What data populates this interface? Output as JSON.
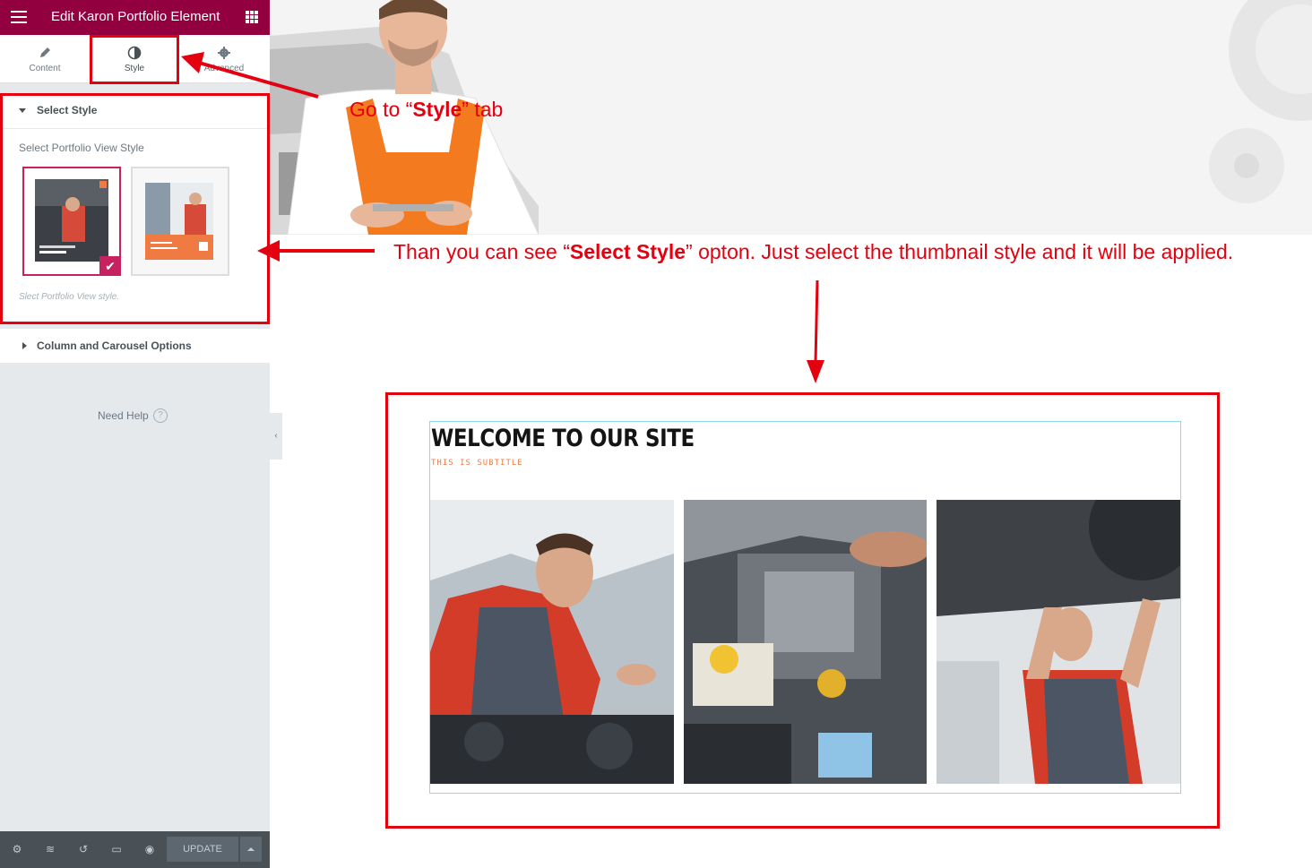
{
  "panel": {
    "title": "Edit Karon Portfolio Element",
    "tabs": [
      {
        "label": "Content",
        "icon": "pencil-icon"
      },
      {
        "label": "Style",
        "icon": "half-circle-icon"
      },
      {
        "label": "Advanced",
        "icon": "gear-icon"
      }
    ],
    "select_style": {
      "title": "Select Style",
      "control_label": "Select Portfolio View Style",
      "thumb_1_selected": true,
      "description": "Slect Portfolio View style."
    },
    "column_carousel": {
      "title": "Column and Carousel Options"
    },
    "need_help": "Need Help",
    "footer": {
      "update_label": "UPDATE"
    }
  },
  "annotations": {
    "go_to_style_pre": "Go  to “",
    "go_to_style_bold": "Style",
    "go_to_style_post": "” tab",
    "select_style_pre": "Than you  can see “",
    "select_style_bold": "Select Style",
    "select_style_post": "” opton. Just select the thumbnail style and it will be applied."
  },
  "preview": {
    "heading": "WELCOME TO OUR SITE",
    "subtitle": "THIS IS SUBTITLE"
  },
  "colors": {
    "brand": "#93003f",
    "accent": "#c5225f",
    "annotation": "#e3000f",
    "subtitle": "#ef7b43"
  }
}
